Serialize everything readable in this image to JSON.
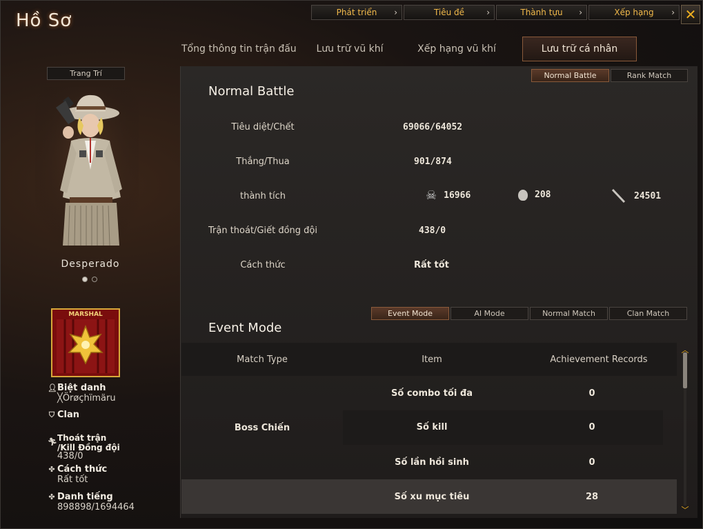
{
  "window": {
    "title": "Hồ Sơ",
    "close_label": "✕"
  },
  "top_nav": [
    {
      "label": "Phát triển"
    },
    {
      "label": "Tiêu đề"
    },
    {
      "label": "Thành tựu"
    },
    {
      "label": "Xếp hạng"
    }
  ],
  "tabs": [
    {
      "label": "Tổng thông tin trận đấu",
      "active": false
    },
    {
      "label": "Lưu trữ vũ khí",
      "active": false
    },
    {
      "label": "Xếp hạng vũ khí",
      "active": false
    },
    {
      "label": "Lưu trữ cá nhân",
      "active": true
    }
  ],
  "left": {
    "decor_button": "Trang Trí",
    "character_name": "Desperado",
    "rank_label": "MARSHAL",
    "nickname_label": "Biệt danh",
    "nickname": "╳Örøçhïmäru",
    "clan_label": "Clan",
    "quit_label_1": "Thoát trận",
    "quit_label_2": "/Kill Đồng đội",
    "quit_value": "438/0",
    "manner_label": "Cách thức",
    "manner_value": "Rất tốt",
    "reputation_label": "Danh tiếng",
    "reputation_value": "898898/1694464"
  },
  "battle_mode_buttons": [
    {
      "label": "Normal Battle",
      "active": true
    },
    {
      "label": "Rank Match",
      "active": false
    }
  ],
  "normal_battle": {
    "title": "Normal Battle",
    "kd_label": "Tiêu diệt/Chết",
    "kd_value": "69066/64052",
    "wl_label": "Thắng/Thua",
    "wl_value": "901/874",
    "ach_label": "thành tích",
    "ach_headshot": "16966",
    "ach_grenade": "208",
    "ach_knife": "24501",
    "quit_label": "Trận thoát/Giết đồng đội",
    "quit_value": "438/0",
    "manner_label": "Cách thức",
    "manner_value": "Rất tốt"
  },
  "event_mode_buttons": [
    {
      "label": "Event Mode",
      "active": true
    },
    {
      "label": "AI Mode",
      "active": false
    },
    {
      "label": "Normal Match",
      "active": false
    },
    {
      "label": "Clan Match",
      "active": false
    }
  ],
  "event_mode": {
    "title": "Event Mode",
    "columns": [
      "Match Type",
      "Item",
      "Achievement Records"
    ],
    "match_type": "Boss Chiến",
    "rows": [
      {
        "item": "Số combo tối đa",
        "value": "0"
      },
      {
        "item": "Số kill",
        "value": "0"
      },
      {
        "item": "Số lần hồi sinh",
        "value": "0"
      },
      {
        "item": "Số xu mục tiêu",
        "value": "28"
      }
    ]
  },
  "colors": {
    "accent": "#f0b84a",
    "active_tab_border": "#8a5a3a",
    "badge_red": "#7a0d0d",
    "badge_gold": "#d8a83a"
  }
}
